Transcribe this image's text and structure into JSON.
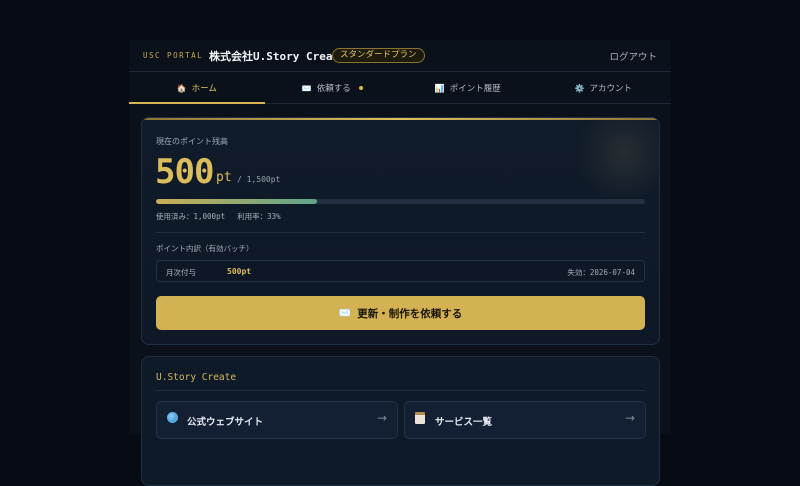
{
  "header": {
    "brand": "USC PORTAL",
    "company": "株式会社U.Story Create",
    "plan": "スタンダードプラン",
    "logout": "ログアウト"
  },
  "tabs": [
    {
      "icon": "home-icon",
      "label": "ホーム",
      "active": true
    },
    {
      "icon": "mail-icon",
      "label": "依頼する",
      "badge_dot": true
    },
    {
      "icon": "chart-icon",
      "label": "ポイント履歴"
    },
    {
      "icon": "gear-icon",
      "label": "アカウント"
    }
  ],
  "points": {
    "label": "現在のポイント残高",
    "balance": "500",
    "unit": "pt",
    "total": "/ 1,500pt",
    "used_fraction": 0.33,
    "used_text": "使用済み：1,000pt",
    "rate_text": "利用率：33%",
    "breakdown_label": "ポイント内訳（有効バッチ）",
    "batches": [
      {
        "type": "月次付与",
        "points": "500pt",
        "expiry": "失効：2026-07-04"
      }
    ],
    "request_button": "更新・制作を依頼する"
  },
  "links": {
    "title": "U.Story Create",
    "items": [
      {
        "icon": "globe-icon",
        "label": "公式ウェブサイト",
        "arrow": "→"
      },
      {
        "icon": "clipboard-icon",
        "label": "サービス一覧",
        "arrow": "→"
      }
    ]
  },
  "colors": {
    "accent_gold": "#d2b253",
    "background": "#070c14",
    "card": "#101b2a",
    "progress_end": "#5ea58d"
  }
}
